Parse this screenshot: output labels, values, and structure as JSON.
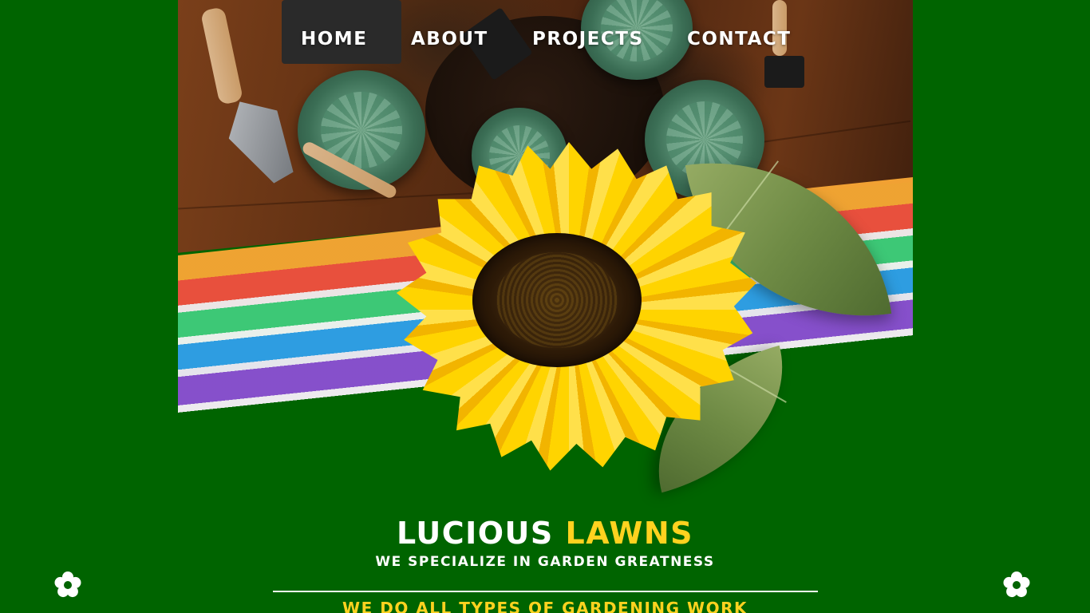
{
  "nav": {
    "items": [
      {
        "label": "HOME"
      },
      {
        "label": "ABOUT"
      },
      {
        "label": "PROJECTS"
      },
      {
        "label": "CONTACT"
      }
    ]
  },
  "hero": {
    "brand_part1": "LUCIOUS",
    "brand_part2": "LAWNS",
    "tagline": "WE SPECIALIZE IN GARDEN GREATNESS",
    "subheading": "WE DO ALL TYPES OF GARDENING WORK"
  },
  "icons": {
    "left": "flower-icon",
    "right": "flower-icon"
  },
  "colors": {
    "background": "#006400",
    "accent_yellow": "#ffd21f",
    "text_white": "#ffffff"
  }
}
